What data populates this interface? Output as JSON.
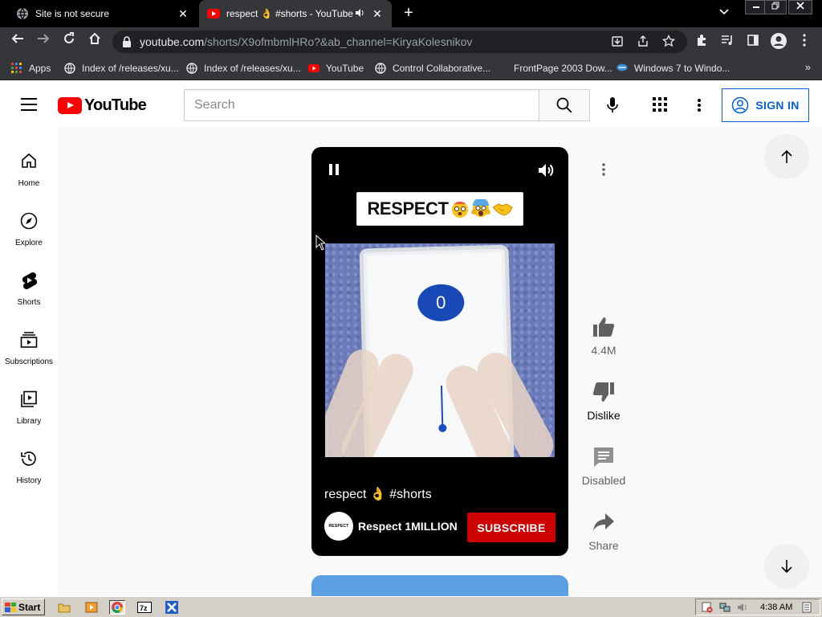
{
  "browser": {
    "tabs": [
      {
        "title": "Site is not secure",
        "active": false
      },
      {
        "title": "respect 👌 #shorts - YouTube",
        "active": true
      }
    ],
    "address": {
      "host": "youtube.com",
      "path": "/shorts/X9ofmbmlHRo?&ab_channel=KiryaKolesnikov"
    },
    "bookmarks": [
      {
        "label": "Apps",
        "icon": "apps-grid-icon"
      },
      {
        "label": "Index of /releases/xu...",
        "icon": "globe-icon"
      },
      {
        "label": "Index of /releases/xu...",
        "icon": "globe-icon"
      },
      {
        "label": "YouTube",
        "icon": "youtube-icon"
      },
      {
        "label": "Control Collaborative...",
        "icon": "globe-icon"
      },
      {
        "label": "FrontPage 2003 Dow...",
        "icon": "bookmark-icon"
      },
      {
        "label": "Windows 7 to Windo...",
        "icon": "windows-icon"
      }
    ],
    "bookmarks_overflow": "»",
    "new_tab": "+",
    "close_glyph": "✕"
  },
  "youtube": {
    "logo_text": "YouTube",
    "search_placeholder": "Search",
    "sign_in": "SIGN IN",
    "guide": [
      {
        "label": "Home",
        "icon": "home-icon"
      },
      {
        "label": "Explore",
        "icon": "compass-icon"
      },
      {
        "label": "Shorts",
        "icon": "shorts-icon"
      },
      {
        "label": "Subscriptions",
        "icon": "subscriptions-icon"
      },
      {
        "label": "Library",
        "icon": "library-icon"
      },
      {
        "label": "History",
        "icon": "history-icon"
      }
    ],
    "short": {
      "caption": "RESPECT",
      "counter": "0",
      "title": "respect 👌 #shorts",
      "channel_name": "Respect 1MILLION",
      "channel_avatar_text": "RESPECT",
      "subscribe": "SUBSCRIBE"
    },
    "actions": [
      {
        "label": "4.4M",
        "icon": "thumb-up-icon"
      },
      {
        "label": "Dislike",
        "icon": "thumb-down-icon"
      },
      {
        "label": "Disabled",
        "icon": "comments-icon"
      },
      {
        "label": "Share",
        "icon": "share-icon"
      }
    ],
    "accent": "#065fd4",
    "subscribe_color": "#cc0000"
  },
  "taskbar": {
    "start": "Start",
    "clock": "4:38 AM"
  }
}
